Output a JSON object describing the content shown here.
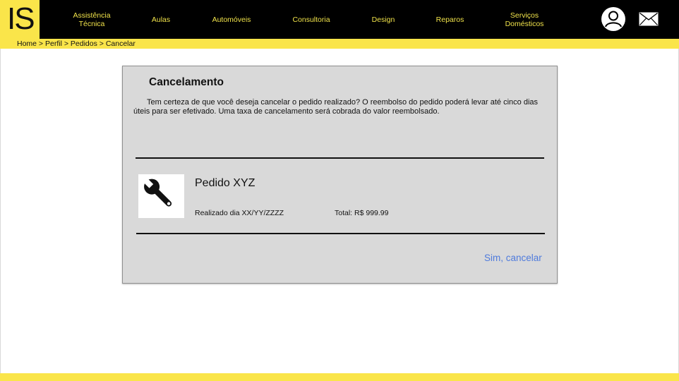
{
  "brand": {
    "logo_text": "IS",
    "accent": "#fae54a",
    "bar": "#000000"
  },
  "nav": [
    {
      "line1": "Assistência",
      "line2": "Técnica"
    },
    {
      "line1": "Aulas",
      "line2": ""
    },
    {
      "line1": "Automóveis",
      "line2": ""
    },
    {
      "line1": "Consultoria",
      "line2": ""
    },
    {
      "line1": "Design",
      "line2": ""
    },
    {
      "line1": "Reparos",
      "line2": ""
    },
    {
      "line1": "Serviços",
      "line2": "Domésticos"
    }
  ],
  "header_icons": {
    "profile": "user-avatar-icon",
    "messages": "mail-icon"
  },
  "breadcrumb": {
    "items": [
      "Home",
      "Perfil",
      "Pedidos",
      "Cancelar"
    ],
    "separator": " > "
  },
  "dialog": {
    "title": "Cancelamento",
    "message": "Tem certeza de que você deseja cancelar o pedido realizado? O reembolso do pedido poderá levar até cinco dias úteis para ser efetivado. Uma taxa de cancelamento será cobrada do valor reembolsado.",
    "order": {
      "name": "Pedido XYZ",
      "date": "Realizado dia XX/YY/ZZZZ",
      "total": "Total: R$ 999.99",
      "icon": "wrench-icon"
    },
    "confirm_label": "Sim, cancelar",
    "confirm_color": "#4f7bdc"
  }
}
